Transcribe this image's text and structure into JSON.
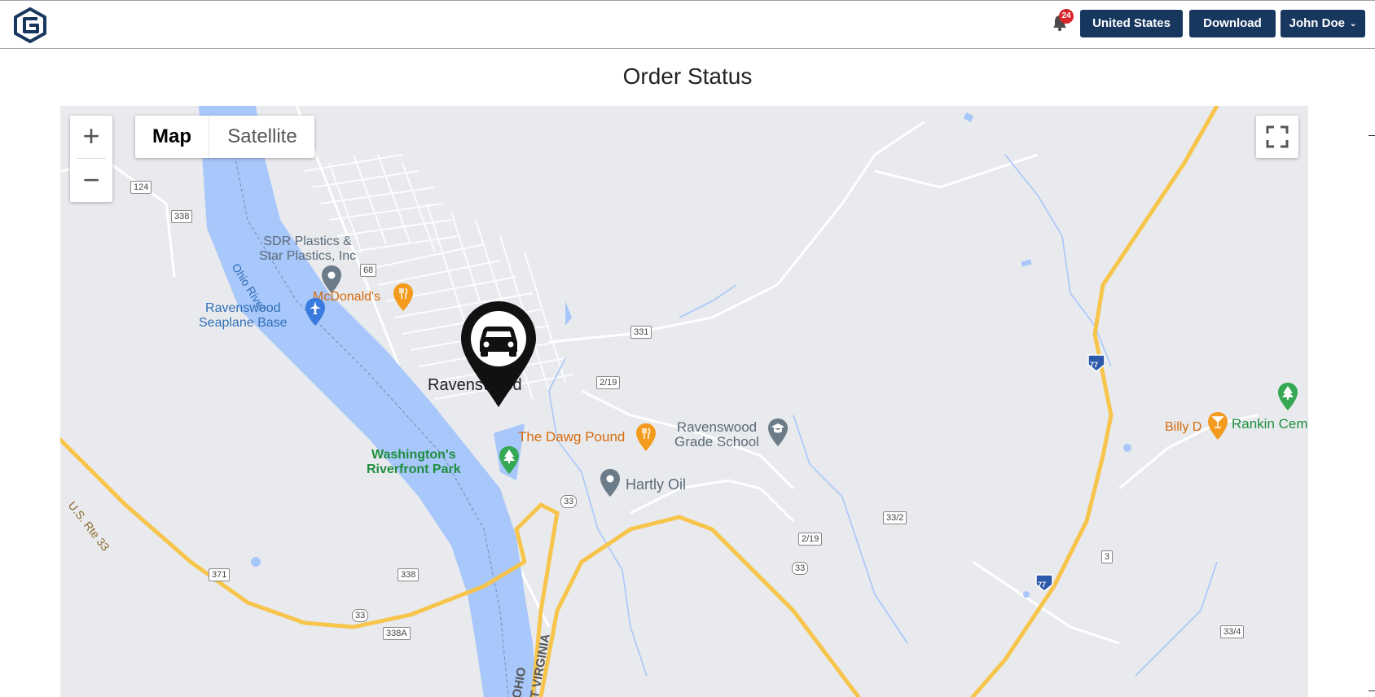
{
  "header": {
    "notifications_count": "24",
    "country_button": "United States",
    "download_button": "Download",
    "user_button": "John Doe"
  },
  "page": {
    "title": "Order Status"
  },
  "map": {
    "controls": {
      "zoom_in": "+",
      "zoom_out": "−",
      "type_map": "Map",
      "type_satellite": "Satellite"
    },
    "town_label": "Ravenswood",
    "places": {
      "sdr_line1": "SDR Plastics &",
      "sdr_line2": "Star Plastics, Inc",
      "mcdonalds": "McDonald's",
      "seaplane_line1": "Ravenswood",
      "seaplane_line2": "Seaplane Base",
      "dawg_pound": "The Dawg Pound",
      "grade_school_line1": "Ravenswood",
      "grade_school_line2": "Grade School",
      "riverfront_line1": "Washington's",
      "riverfront_line2": "Riverfront Park",
      "hartly_oil": "Hartly Oil",
      "billy_d": "Billy D",
      "rankin": "Rankin Cem"
    },
    "water_labels": {
      "ohio_river": "Ohio River"
    },
    "road_labels": {
      "us_rte_33": "U.S. Rte 33",
      "r124": "124",
      "r338a": "338",
      "r68": "68",
      "r331": "331",
      "r2_19a": "2/19",
      "r33a": "33",
      "r33_2": "33/2",
      "r2_19b": "2/19",
      "r33b": "33",
      "r371": "371",
      "r338b": "338",
      "r33c": "33",
      "r338A": "338A",
      "r3": "3",
      "r33_4": "33/4",
      "i77a": "77",
      "i77b": "77"
    },
    "state_labels": {
      "ohio": "OHIO",
      "west_virginia": "T VIRGINIA"
    },
    "marker": {
      "icon": "car-icon"
    }
  },
  "colors": {
    "header_button": "#17375e",
    "badge": "#d9262a",
    "water": "#a8c7fa",
    "land": "#e9eaee",
    "highway": "#f7c44c"
  }
}
